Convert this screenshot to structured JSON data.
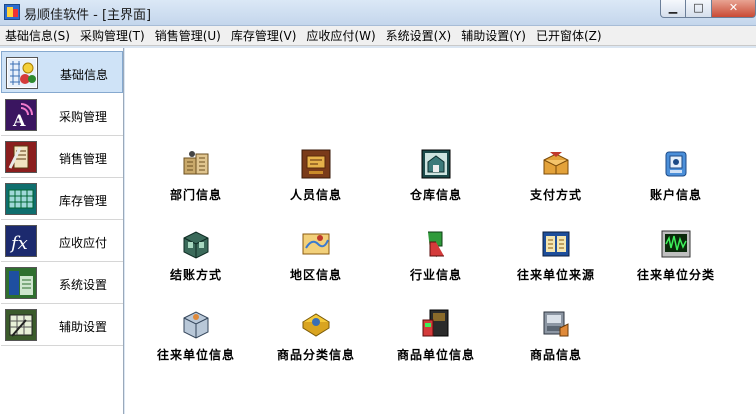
{
  "window": {
    "title": "易顺佳软件 - [主界面]"
  },
  "menu": [
    "基础信息(S)",
    "采购管理(T)",
    "销售管理(U)",
    "库存管理(V)",
    "应收应付(W)",
    "系统设置(X)",
    "辅助设置(Y)",
    "已开窗体(Z)"
  ],
  "sidebar": {
    "items": [
      {
        "label": "基础信息",
        "icon": "basic-info-icon",
        "active": true
      },
      {
        "label": "采购管理",
        "icon": "purchase-icon"
      },
      {
        "label": "销售管理",
        "icon": "sales-icon"
      },
      {
        "label": "库存管理",
        "icon": "inventory-icon"
      },
      {
        "label": "应收应付",
        "icon": "receivable-payable-icon"
      },
      {
        "label": "系统设置",
        "icon": "system-settings-icon"
      },
      {
        "label": "辅助设置",
        "icon": "auxiliary-settings-icon"
      }
    ]
  },
  "tiles": [
    {
      "label": "部门信息",
      "icon": "department-icon"
    },
    {
      "label": "人员信息",
      "icon": "personnel-icon"
    },
    {
      "label": "仓库信息",
      "icon": "warehouse-icon"
    },
    {
      "label": "支付方式",
      "icon": "payment-method-icon"
    },
    {
      "label": "账户信息",
      "icon": "account-icon"
    },
    {
      "label": "结账方式",
      "icon": "settlement-method-icon"
    },
    {
      "label": "地区信息",
      "icon": "region-icon"
    },
    {
      "label": "行业信息",
      "icon": "industry-icon"
    },
    {
      "label": "往来单位来源",
      "icon": "partner-source-icon"
    },
    {
      "label": "往来单位分类",
      "icon": "partner-category-icon"
    },
    {
      "label": "往来单位信息",
      "icon": "partner-info-icon"
    },
    {
      "label": "商品分类信息",
      "icon": "product-category-icon"
    },
    {
      "label": "商品单位信息",
      "icon": "product-unit-icon"
    },
    {
      "label": "商品信息",
      "icon": "product-info-icon"
    }
  ]
}
